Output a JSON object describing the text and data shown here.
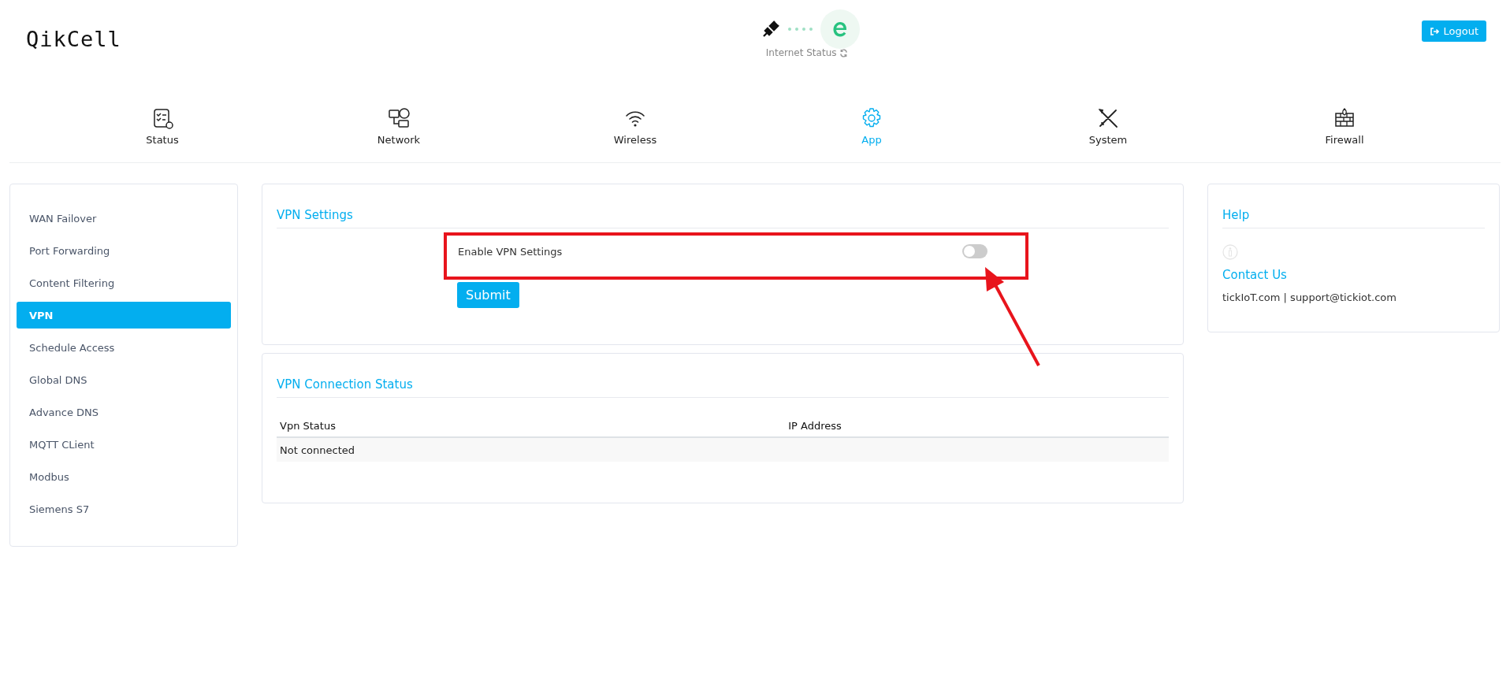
{
  "header": {
    "logo": "QikCell",
    "internet_status": "Internet Status",
    "logout": "Logout"
  },
  "nav": [
    {
      "label": "Status",
      "selected": false
    },
    {
      "label": "Network",
      "selected": false
    },
    {
      "label": "Wireless",
      "selected": false
    },
    {
      "label": "App",
      "selected": true
    },
    {
      "label": "System",
      "selected": false
    },
    {
      "label": "Firewall",
      "selected": false
    }
  ],
  "sidebar": {
    "items": [
      {
        "label": "WAN Failover",
        "selected": false
      },
      {
        "label": "Port Forwarding",
        "selected": false
      },
      {
        "label": "Content Filtering",
        "selected": false
      },
      {
        "label": "VPN",
        "selected": true
      },
      {
        "label": "Schedule Access",
        "selected": false
      },
      {
        "label": "Global DNS",
        "selected": false
      },
      {
        "label": "Advance DNS",
        "selected": false
      },
      {
        "label": "MQTT CLient",
        "selected": false
      },
      {
        "label": "Modbus",
        "selected": false
      },
      {
        "label": "Siemens S7",
        "selected": false
      }
    ]
  },
  "vpn_settings": {
    "title": "VPN Settings",
    "toggle": {
      "label": "Enable VPN Settings",
      "on": false
    },
    "submit": "Submit"
  },
  "connection_status": {
    "title": "VPN Connection Status",
    "columns": [
      "Vpn Status",
      "IP Address"
    ],
    "rows": [
      [
        "Not connected",
        null
      ]
    ]
  },
  "help": {
    "title": "Help",
    "contact_title": "Contact Us",
    "contact_text": "tickIoT.com | support@tickiot.com"
  }
}
